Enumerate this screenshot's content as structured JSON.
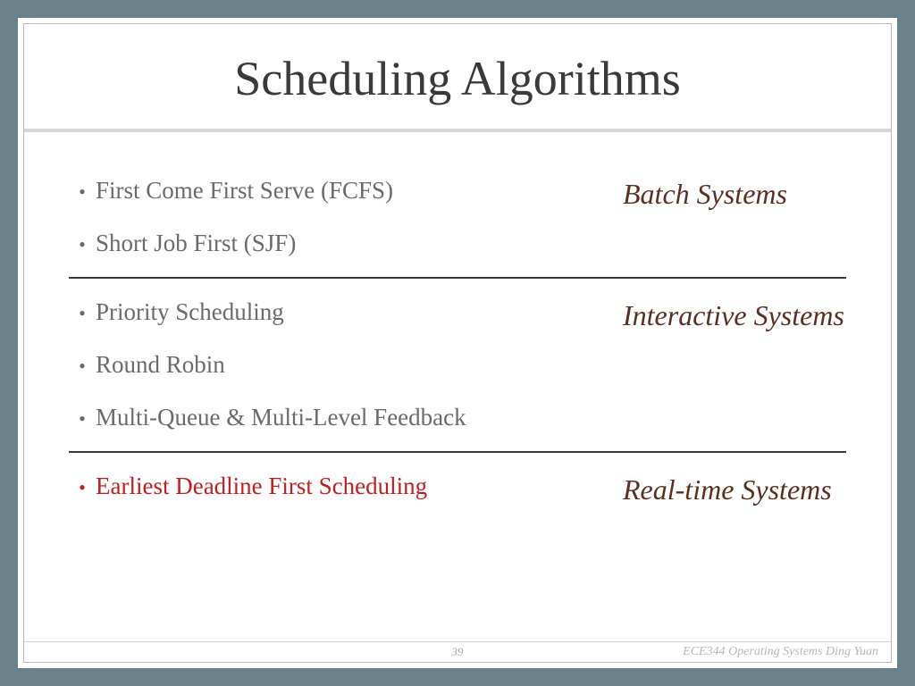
{
  "slide": {
    "title": "Scheduling Algorithms",
    "sections": [
      {
        "category": "Batch Systems",
        "items": [
          {
            "text": "First Come First Serve (FCFS)",
            "highlight": false
          },
          {
            "text": "Short Job First (SJF)",
            "highlight": false
          }
        ]
      },
      {
        "category": "Interactive Systems",
        "items": [
          {
            "text": "Priority Scheduling",
            "highlight": false
          },
          {
            "text": "Round Robin",
            "highlight": false
          },
          {
            "text": "Multi-Queue & Multi-Level Feedback",
            "highlight": false
          }
        ]
      },
      {
        "category": "Real-time Systems",
        "items": [
          {
            "text": "Earliest Deadline First Scheduling",
            "highlight": true
          }
        ]
      }
    ],
    "footer": {
      "page": "39",
      "course": "ECE344 Operating Systems Ding Yuan"
    }
  }
}
